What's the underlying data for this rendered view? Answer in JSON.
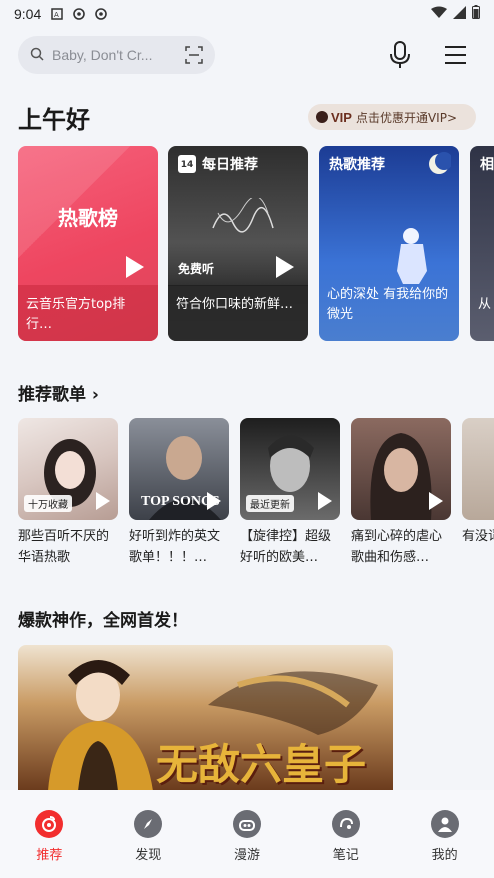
{
  "status": {
    "time": "9:04"
  },
  "search": {
    "placeholder": "Baby, Don't Cr..."
  },
  "greeting": "上午好",
  "vip": {
    "tag": "VIP",
    "text": "点击优惠开通VIP>"
  },
  "cards": [
    {
      "title": "热歌榜",
      "caption": "云音乐官方top排行…",
      "color": "#f0506a"
    },
    {
      "header": "每日推荐",
      "badge": "免费听",
      "caption": "符合你口味的新鲜…",
      "color": "#3c3c3c"
    },
    {
      "header": "热歌推荐",
      "caption": "心的深处 有我给你的微光",
      "color": "#2a55b8"
    },
    {
      "header": "相",
      "caption": "从",
      "color": "#3b3f52"
    }
  ],
  "playlist_section": {
    "title": "推荐歌单"
  },
  "playlists": [
    {
      "badge": "十万收藏",
      "name": "那些百听不厌的华语热歌"
    },
    {
      "badge": "",
      "name": "好听到炸的英文歌单！！！…",
      "overlay": "TOP SONGS"
    },
    {
      "badge": "最近更新",
      "name": "【旋律控】超级好听的欧美…"
    },
    {
      "badge": "",
      "name": "痛到心碎的虐心歌曲和伤感…"
    },
    {
      "badge": "",
      "name": "有没词直"
    }
  ],
  "banner_section": {
    "title": "爆款神作，全网首发！"
  },
  "banner": {
    "text": "无敌六皇子"
  },
  "tabs": [
    {
      "label": "推荐",
      "icon": "netease-logo-icon",
      "active": true
    },
    {
      "label": "发现",
      "icon": "compass-icon",
      "active": false
    },
    {
      "label": "漫游",
      "icon": "radio-icon",
      "active": false
    },
    {
      "label": "笔记",
      "icon": "chat-icon",
      "active": false
    },
    {
      "label": "我的",
      "icon": "user-icon",
      "active": false
    }
  ]
}
